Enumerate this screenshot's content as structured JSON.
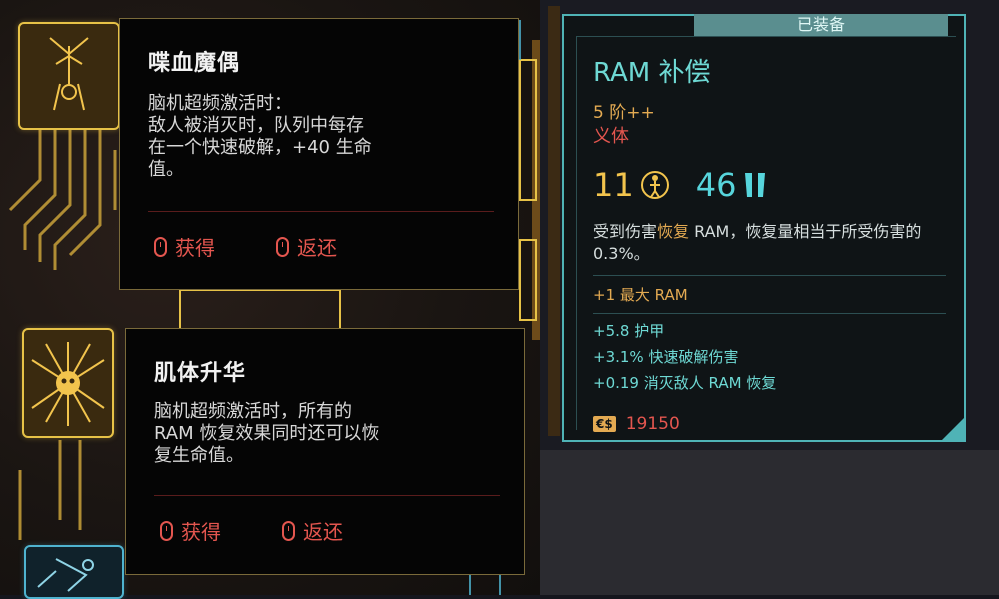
{
  "perks": [
    {
      "title": "喋血魔偶",
      "description": "脑机超频激活时：\n敌人被消灭时，队列中每存\n在一个快速破解，+40 生命\n值。",
      "actions": [
        {
          "label": "获得"
        },
        {
          "label": "返还"
        }
      ]
    },
    {
      "title": "肌体升华",
      "description": "脑机超频激活时，所有的\nRAM 恢复效果同时还可以恢\n复生命值。",
      "actions": [
        {
          "label": "获得"
        },
        {
          "label": "返还"
        }
      ]
    }
  ],
  "item": {
    "equipped_label": "已装备",
    "name": "RAM 补偿",
    "tier": "5 阶++",
    "type": "义体",
    "capacity": "11",
    "armor": "46",
    "desc_prefix": "受到伤害",
    "desc_highlight": "恢复",
    "desc_suffix": " RAM，恢复量相当于所受伤害的 0.3%。",
    "max_ram": "+1 最大 RAM",
    "mods": [
      "+5.8 护甲",
      "+3.1% 快速破解伤害",
      "+0.19 消灭敌人 RAM 恢复"
    ],
    "currency_icon": "€$",
    "price": "19150"
  },
  "colors": {
    "gold": "#f2c44d",
    "cyan": "#57d5dc",
    "red": "#e4564f",
    "orange": "#e3aa52"
  }
}
